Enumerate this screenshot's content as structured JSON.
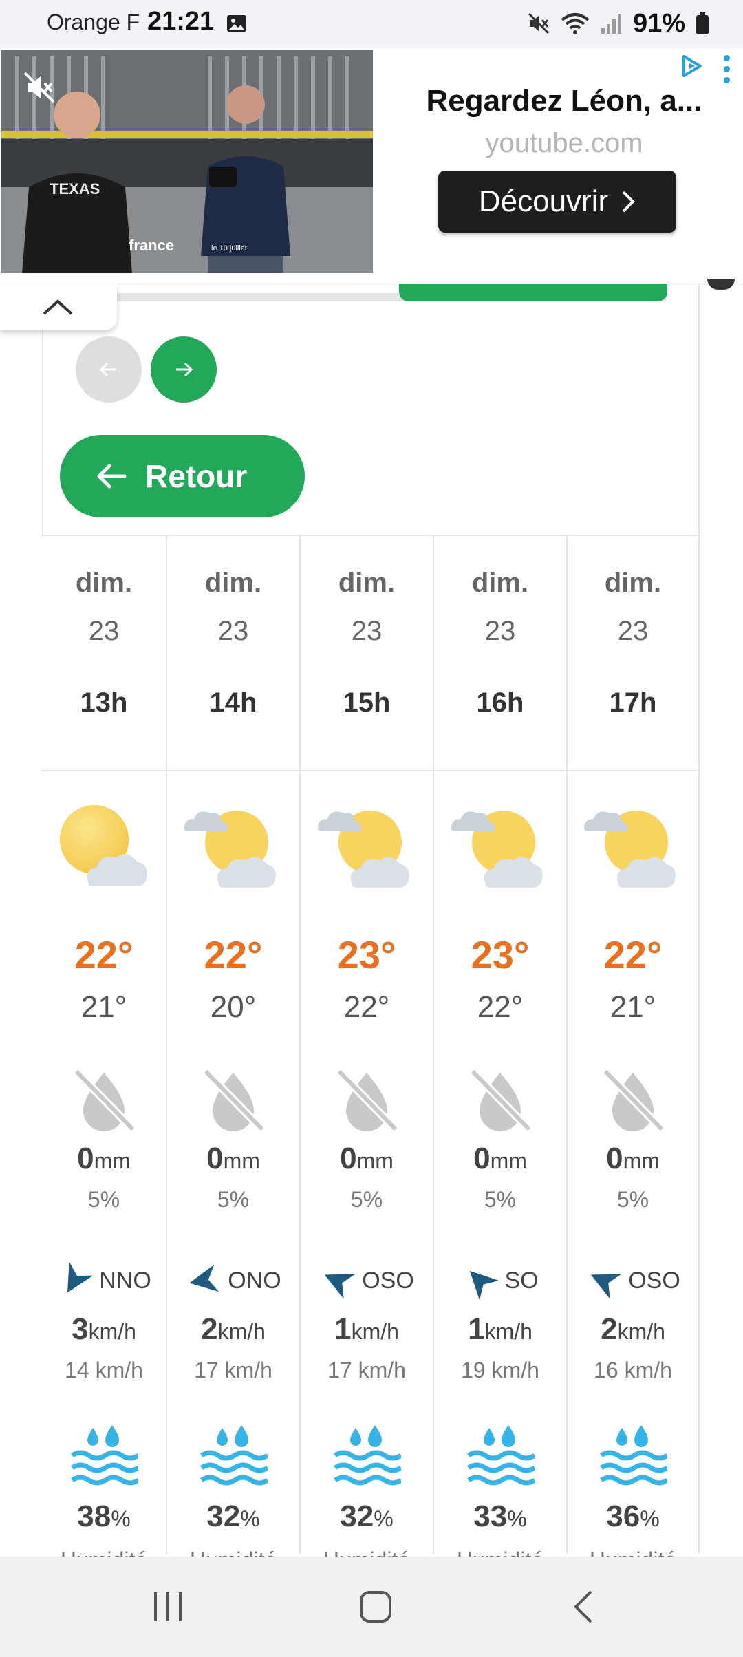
{
  "status_bar": {
    "carrier": "Orange F",
    "time": "21:21",
    "battery": "91%"
  },
  "ad": {
    "title": "Regardez Léon, a...",
    "domain": "youtube.com",
    "cta": "Découvrir",
    "video_channel": "france",
    "video_date": "le 10 juillet",
    "video_shirt_text": "TEXAS"
  },
  "panel": {
    "back_label": "Retour"
  },
  "forecast": [
    {
      "day": "dim.",
      "date": "23",
      "hour": "13h",
      "icon": "sun-cloud",
      "tmax": "22°",
      "tmin": "21°",
      "rain_value": "0",
      "rain_unit": "mm",
      "rain_prob": "5%",
      "wind_dir": "NNO",
      "wind_arrow_deg": -60,
      "wind_speed": "3",
      "wind_unit": "km/h",
      "gust": "14 km/h",
      "humidity": "38",
      "humidity_unit": "%",
      "humidity_label": "Humidité"
    },
    {
      "day": "dim.",
      "date": "23",
      "hour": "14h",
      "icon": "sun-clouds",
      "tmax": "22°",
      "tmin": "20°",
      "rain_value": "0",
      "rain_unit": "mm",
      "rain_prob": "5%",
      "wind_dir": "ONO",
      "wind_arrow_deg": -10,
      "wind_speed": "2",
      "wind_unit": "km/h",
      "gust": "17 km/h",
      "humidity": "32",
      "humidity_unit": "%",
      "humidity_label": "Humidité"
    },
    {
      "day": "dim.",
      "date": "23",
      "hour": "15h",
      "icon": "sun-clouds",
      "tmax": "23°",
      "tmin": "22°",
      "rain_value": "0",
      "rain_unit": "mm",
      "rain_prob": "5%",
      "wind_dir": "OSO",
      "wind_arrow_deg": 25,
      "wind_speed": "1",
      "wind_unit": "km/h",
      "gust": "17 km/h",
      "humidity": "32",
      "humidity_unit": "%",
      "humidity_label": "Humidité"
    },
    {
      "day": "dim.",
      "date": "23",
      "hour": "16h",
      "icon": "sun-clouds",
      "tmax": "23°",
      "tmin": "22°",
      "rain_value": "0",
      "rain_unit": "mm",
      "rain_prob": "5%",
      "wind_dir": "SO",
      "wind_arrow_deg": 45,
      "wind_speed": "1",
      "wind_unit": "km/h",
      "gust": "19 km/h",
      "humidity": "33",
      "humidity_unit": "%",
      "humidity_label": "Humidité"
    },
    {
      "day": "dim.",
      "date": "23",
      "hour": "17h",
      "icon": "sun-clouds",
      "tmax": "22°",
      "tmin": "21°",
      "rain_value": "0",
      "rain_unit": "mm",
      "rain_prob": "5%",
      "wind_dir": "OSO",
      "wind_arrow_deg": 25,
      "wind_speed": "2",
      "wind_unit": "km/h",
      "gust": "16 km/h",
      "humidity": "36",
      "humidity_unit": "%",
      "humidity_label": "Humidité"
    }
  ],
  "colors": {
    "accent_green": "#23a85a",
    "temp_max": "#e8701f",
    "wind_arrow": "#1f5a80",
    "ad_icon": "#2aa3d4"
  },
  "icons": {
    "sun_cloud": "partly-cloudy-icon",
    "no_rain": "no-rain-drop-icon",
    "wind": "wind-direction-arrow-icon",
    "humidity": "humidity-waves-icon"
  }
}
